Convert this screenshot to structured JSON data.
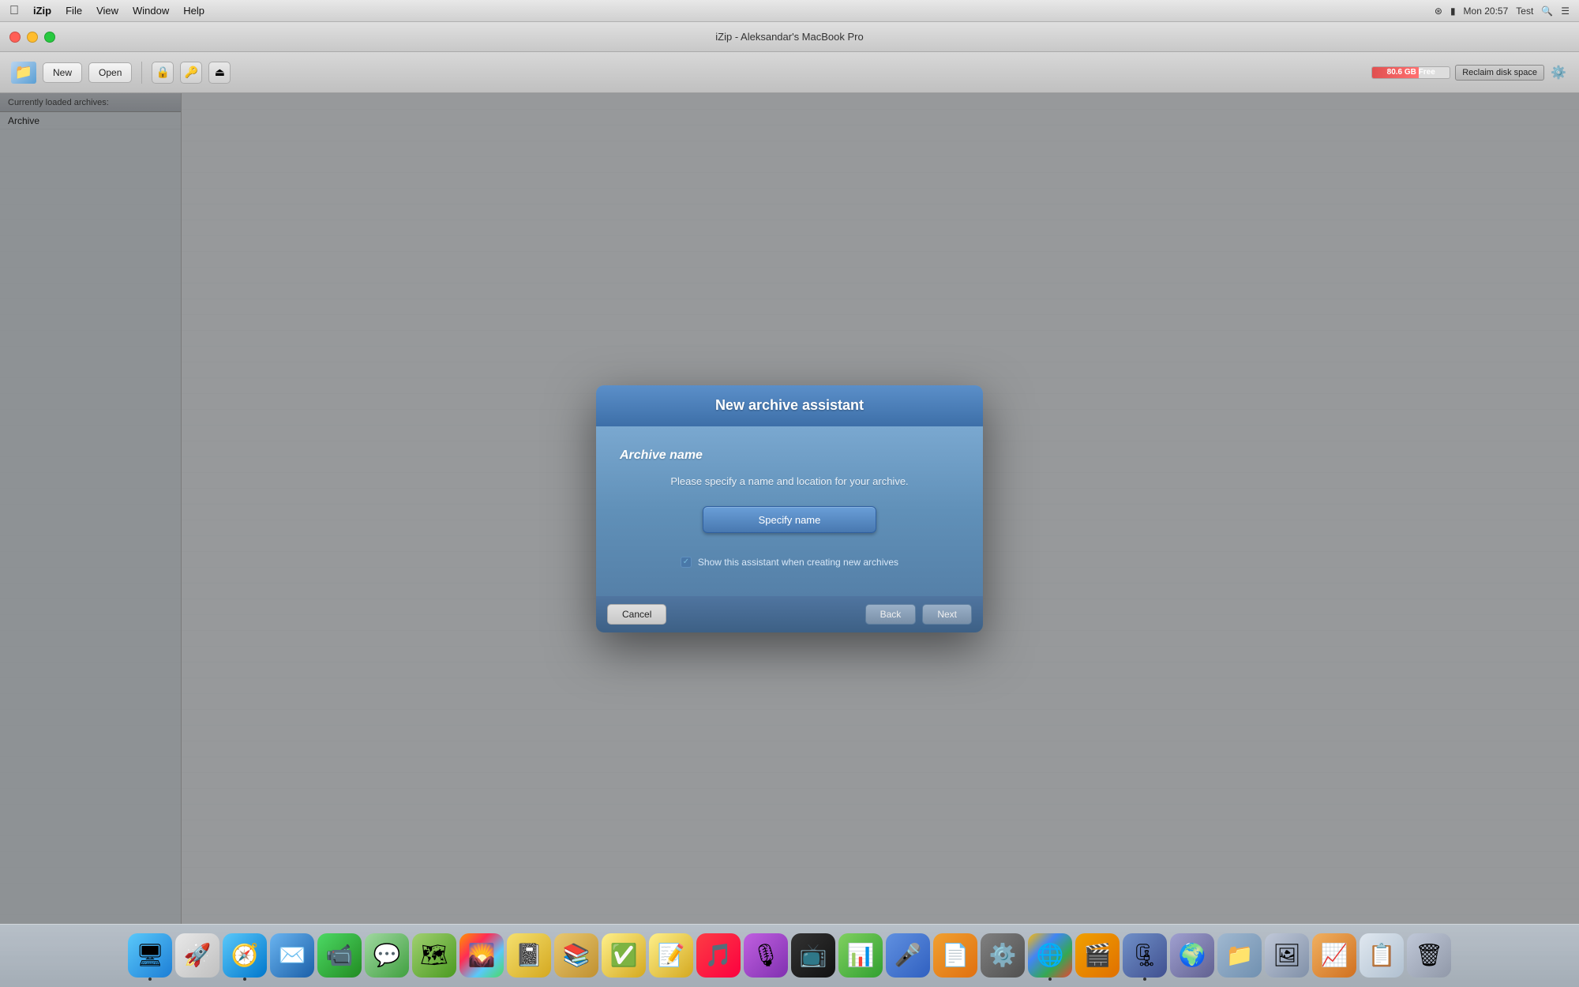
{
  "menubar": {
    "app_name": "iZip",
    "items": [
      "File",
      "View",
      "Window",
      "Help"
    ],
    "right": {
      "wifi": "WiFi",
      "battery": "Battery",
      "time": "Mon 20:57",
      "user": "Test"
    }
  },
  "titlebar": {
    "title": "iZip - Aleksandar's MacBook Pro"
  },
  "toolbar": {
    "new_label": "New",
    "open_label": "Open",
    "disk_space": "80.6 GB Free",
    "reclaim_label": "Reclaim disk space"
  },
  "sidebar": {
    "header": "Currently loaded archives:",
    "item": "Archive"
  },
  "modal": {
    "title": "New archive assistant",
    "section_label": "Archive name",
    "description": "Please specify a name and location for your archive.",
    "specify_name_btn": "Specify name",
    "checkbox_label": "Show this assistant when creating new archives",
    "cancel_btn": "Cancel",
    "back_btn": "Back",
    "next_btn": "Next"
  },
  "dock": {
    "icons": [
      {
        "name": "finder-icon",
        "emoji": "🖥",
        "class": "di-finder",
        "active": true
      },
      {
        "name": "launchpad-icon",
        "emoji": "🚀",
        "class": "di-rocket"
      },
      {
        "name": "safari-icon",
        "emoji": "🧭",
        "class": "di-safari",
        "active": true
      },
      {
        "name": "mail-icon",
        "emoji": "✉️",
        "class": "di-mail"
      },
      {
        "name": "facetime-icon",
        "emoji": "📹",
        "class": "di-facetime"
      },
      {
        "name": "messages-icon",
        "emoji": "💬",
        "class": "di-messages"
      },
      {
        "name": "maps-icon",
        "emoji": "🗺",
        "class": "di-maps"
      },
      {
        "name": "photos-icon",
        "emoji": "🌄",
        "class": "di-photos"
      },
      {
        "name": "contacts-icon",
        "emoji": "📓",
        "class": "di-notesold"
      },
      {
        "name": "kindle-icon",
        "emoji": "📚",
        "class": "di-kindle"
      },
      {
        "name": "tasks-icon",
        "emoji": "✅",
        "class": "di-notes"
      },
      {
        "name": "stickies-icon",
        "emoji": "📝",
        "class": "di-notes"
      },
      {
        "name": "music-icon",
        "emoji": "🎵",
        "class": "di-music"
      },
      {
        "name": "podcasts-icon",
        "emoji": "🎙",
        "class": "di-podcasts"
      },
      {
        "name": "appletv-icon",
        "emoji": "📺",
        "class": "di-appletv"
      },
      {
        "name": "numbers-icon",
        "emoji": "📊",
        "class": "di-numbers"
      },
      {
        "name": "keynote-icon",
        "emoji": "🎤",
        "class": "di-keynote"
      },
      {
        "name": "pages-icon",
        "emoji": "📄",
        "class": "di-pages"
      },
      {
        "name": "sysprefs-icon",
        "emoji": "⚙️",
        "class": "di-sysprefsold"
      },
      {
        "name": "chrome-icon",
        "emoji": "🌐",
        "class": "di-chrome",
        "active": true
      },
      {
        "name": "vlc-icon",
        "emoji": "🎬",
        "class": "di-vlc"
      },
      {
        "name": "izip-icon",
        "emoji": "🗜",
        "class": "di-izip",
        "active": true
      },
      {
        "name": "migration-icon",
        "emoji": "🌍",
        "class": "di-migration"
      },
      {
        "name": "finder3-icon",
        "emoji": "📁",
        "class": "di-finder2"
      },
      {
        "name": "window-icon",
        "emoji": "🖼",
        "class": "di-window"
      },
      {
        "name": "activity-icon",
        "emoji": "📈",
        "class": "di-chart"
      },
      {
        "name": "list2-icon",
        "emoji": "📋",
        "class": "di-list"
      },
      {
        "name": "trash-icon",
        "emoji": "🗑",
        "class": "di-trash"
      }
    ]
  }
}
